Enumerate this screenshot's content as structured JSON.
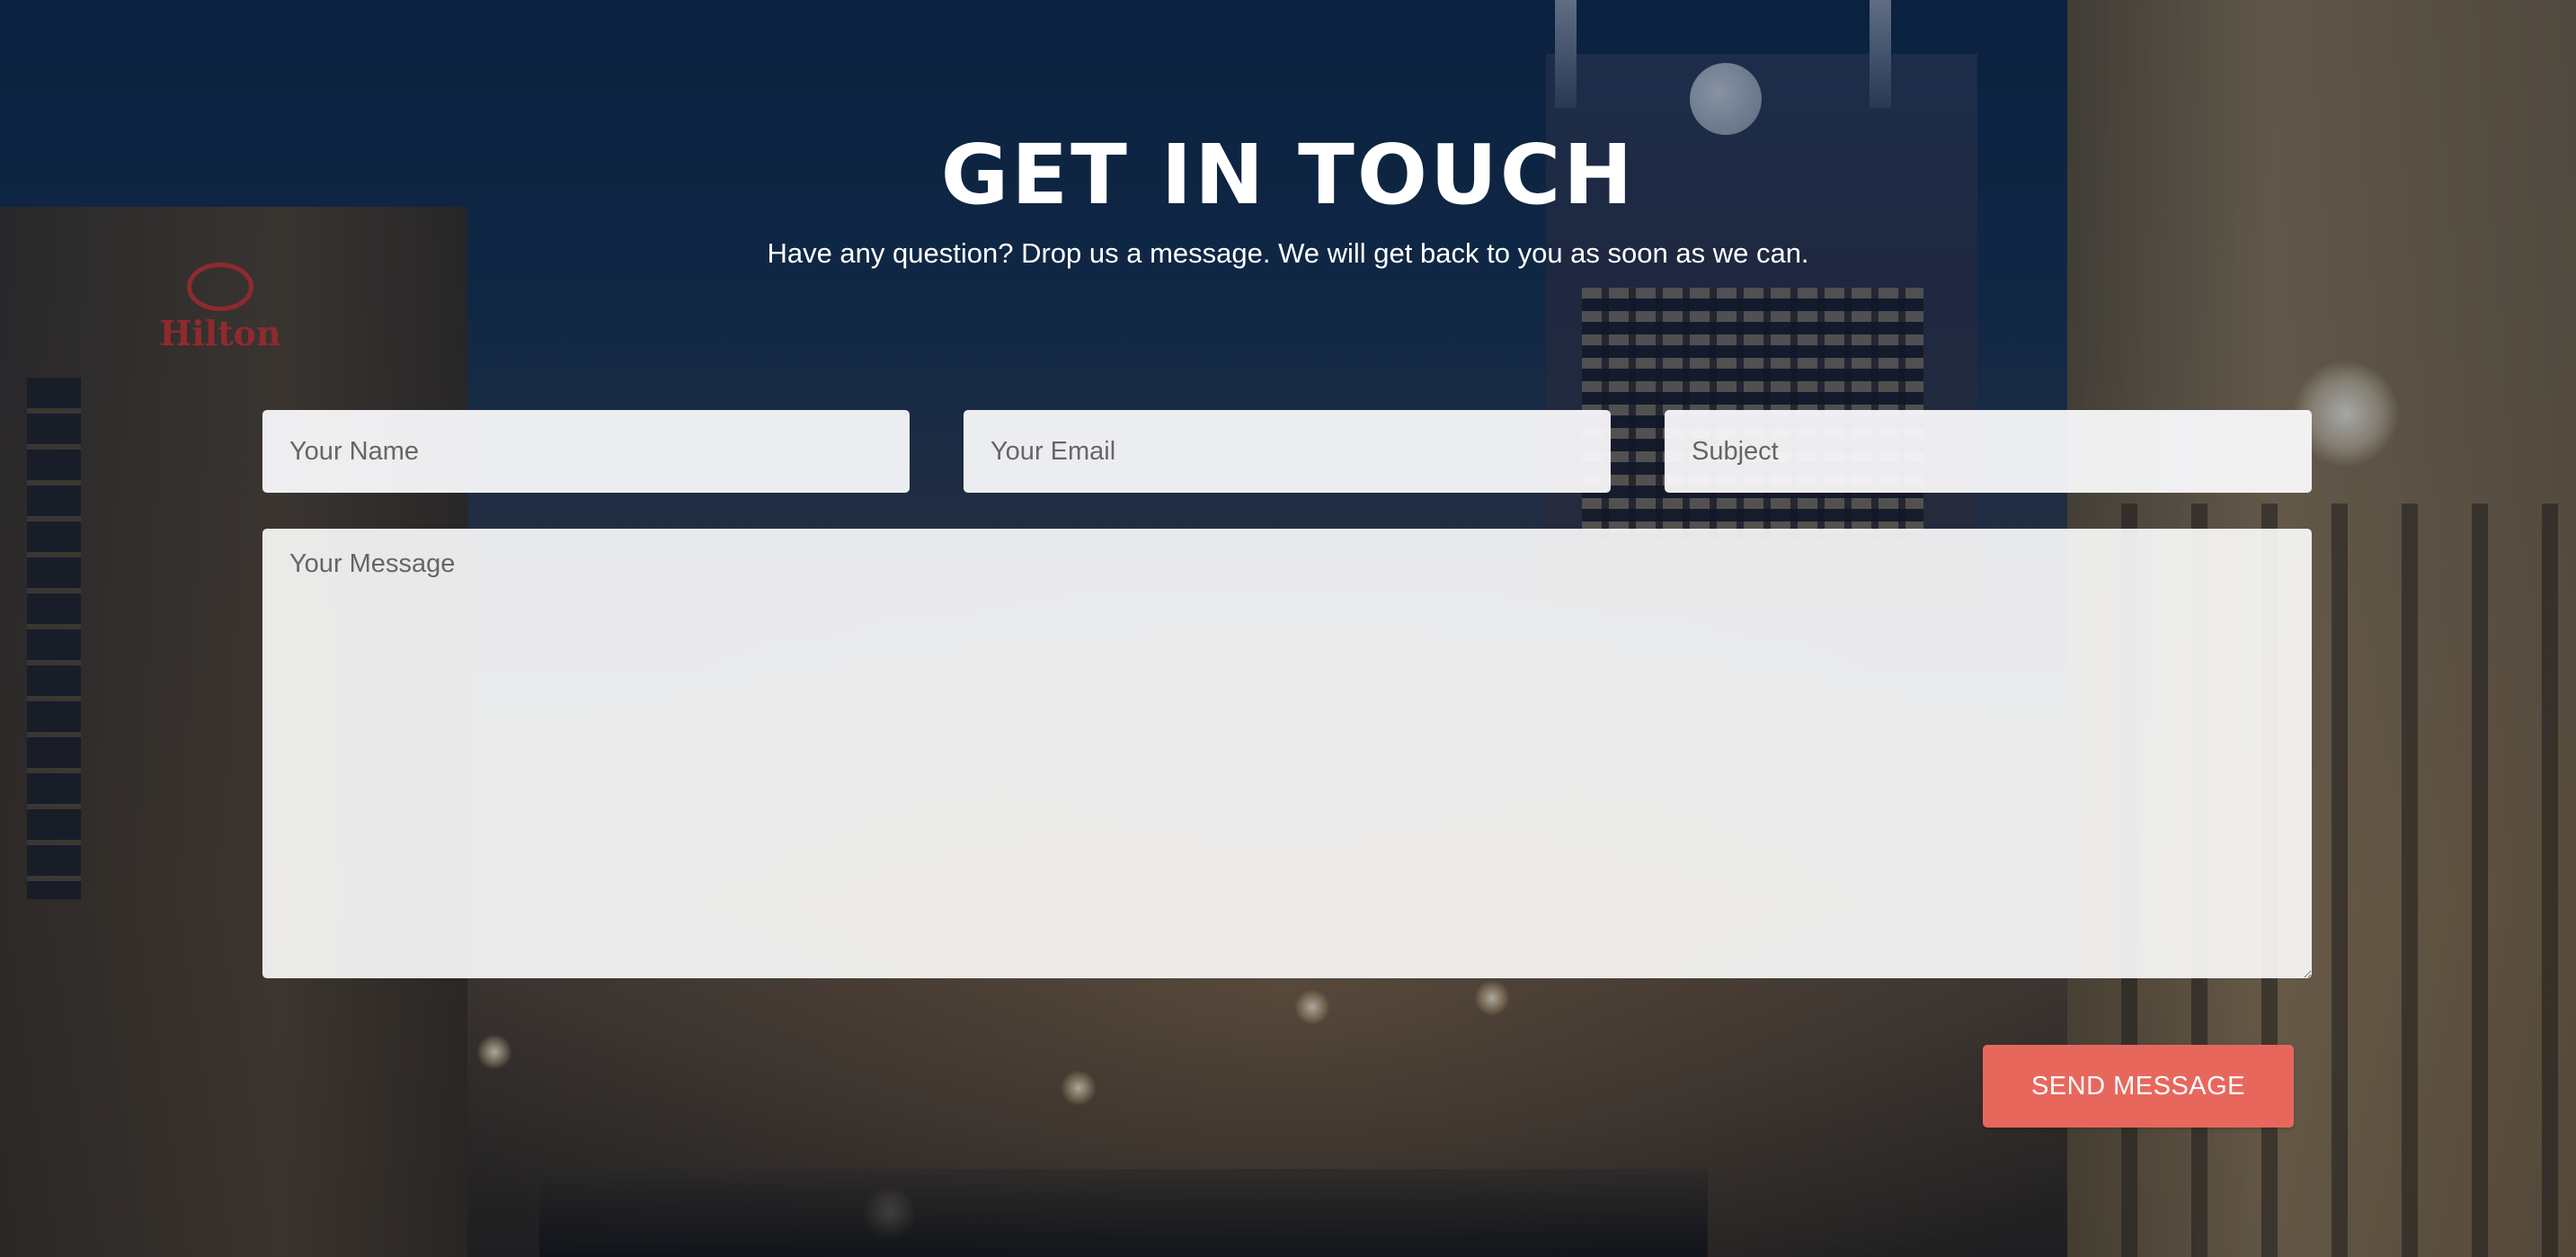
{
  "section": {
    "title": "GET IN TOUCH",
    "subtitle": "Have any question? Drop us a message. We will get back to you as soon as we can."
  },
  "form": {
    "name_placeholder": "Your Name",
    "email_placeholder": "Your Email",
    "subject_placeholder": "Subject",
    "message_placeholder": "Your Message",
    "name_value": "",
    "email_value": "",
    "subject_value": "",
    "message_value": "",
    "submit_label": "SEND MESSAGE"
  },
  "background": {
    "sign_text": "Hilton",
    "scene": "night city street"
  },
  "colors": {
    "accent": "#e8675d",
    "title_text": "#ffffff",
    "field_bg": "#f5f5f7",
    "placeholder": "#666666"
  }
}
